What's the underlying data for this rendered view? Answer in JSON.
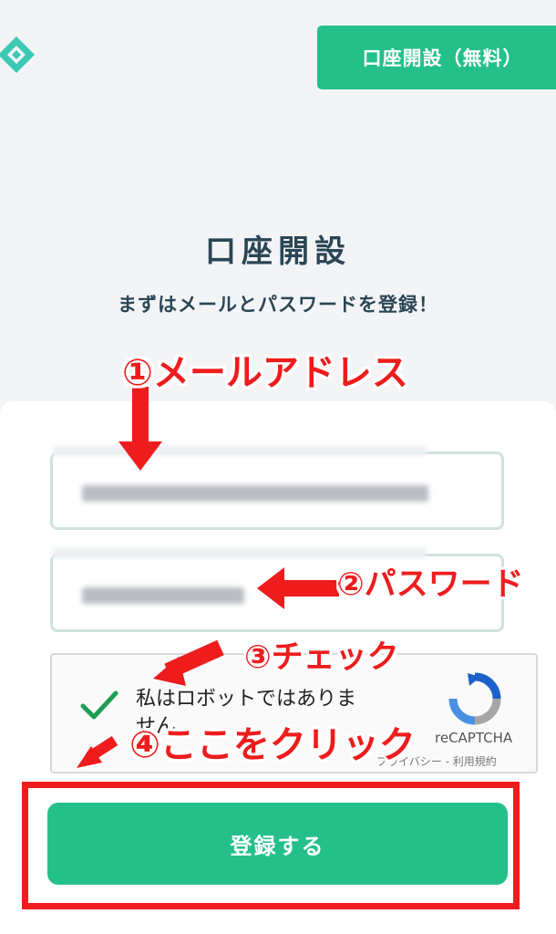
{
  "header": {
    "signup_label": "口座開設（無料）"
  },
  "page": {
    "title": "口座開設",
    "subtitle": "まずはメールとパスワードを登録！"
  },
  "recaptcha": {
    "label": "私はロボットではありません",
    "brand": "reCAPTCHA",
    "links": "プライバシー - 利用規約"
  },
  "form": {
    "submit_label": "登録する"
  },
  "annotations": {
    "email": "①メールアドレス",
    "password": "②パスワード",
    "check": "③チェック",
    "click": "④ここをクリック"
  },
  "colors": {
    "brand_green": "#25c08a",
    "annotation_red": "#ee1c1c",
    "title_text": "#2b4654"
  }
}
